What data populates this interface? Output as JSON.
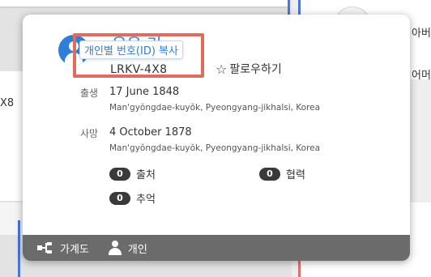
{
  "background": {
    "right_text_1": "아버",
    "right_text_2": "어머",
    "left_text": "X8"
  },
  "person": {
    "name_partial": "유유 기",
    "pid": "LRKV-4X8",
    "copy_id_tooltip": "개인별 번호(ID) 복사",
    "follow_label": "팔로우하기"
  },
  "events": {
    "birth": {
      "label": "출생",
      "date": "17 June 1848",
      "place": "Man'gyŏngdae-kuyŏk, Pyeongyang-jikhalsi, Korea"
    },
    "death": {
      "label": "사망",
      "date": "4 October 1878",
      "place": "Man'gyŏngdae-kuyŏk, Pyeongyang-jikhalsi, Korea"
    }
  },
  "counts": {
    "sources": {
      "count": "0",
      "label": "출처"
    },
    "collaboration": {
      "count": "0",
      "label": "협력"
    },
    "memories": {
      "count": "0",
      "label": "추억"
    }
  },
  "footer": {
    "tree_label": "가계도",
    "person_label": "개인"
  },
  "colors": {
    "accent_blue": "#2f7fd8",
    "highlight_red": "#e06c5c",
    "footer_bg": "#6b6b6b"
  }
}
